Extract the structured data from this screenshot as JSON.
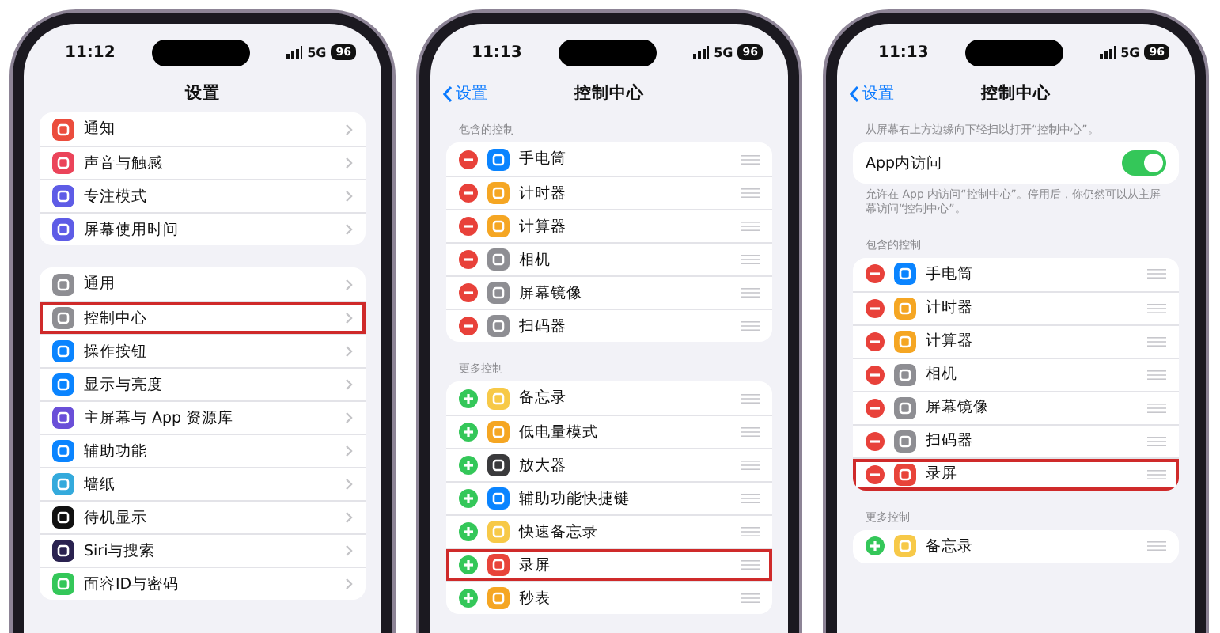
{
  "phones": [
    {
      "status_bar": {
        "time": "11:12",
        "network": "5G",
        "battery": "96"
      },
      "nav": {
        "title": "设置"
      },
      "sections": [
        {
          "rows": [
            {
              "kind": "link",
              "label": "通知",
              "color": "#eb4d3d",
              "highlighted": false
            },
            {
              "kind": "link",
              "label": "声音与触感",
              "color": "#eb445a",
              "highlighted": false
            },
            {
              "kind": "link",
              "label": "专注模式",
              "color": "#5e5ce6",
              "highlighted": false
            },
            {
              "kind": "link",
              "label": "屏幕使用时间",
              "color": "#5e5ce6",
              "highlighted": false
            }
          ]
        },
        {
          "rows": [
            {
              "kind": "link",
              "label": "通用",
              "color": "#8e8e93",
              "highlighted": false
            },
            {
              "kind": "link",
              "label": "控制中心",
              "color": "#8e8e93",
              "highlighted": true
            },
            {
              "kind": "link",
              "label": "操作按钮",
              "color": "#0a84ff",
              "highlighted": false
            },
            {
              "kind": "link",
              "label": "显示与亮度",
              "color": "#0a84ff",
              "highlighted": false
            },
            {
              "kind": "link",
              "label": "主屏幕与 App 资源库",
              "color": "#6a4fd8",
              "highlighted": false
            },
            {
              "kind": "link",
              "label": "辅助功能",
              "color": "#0a84ff",
              "highlighted": false
            },
            {
              "kind": "link",
              "label": "墙纸",
              "color": "#34aadc",
              "highlighted": false
            },
            {
              "kind": "link",
              "label": "待机显示",
              "color": "#111111",
              "highlighted": false
            },
            {
              "kind": "link",
              "label": "Siri与搜索",
              "color": "#2a2250",
              "highlighted": false
            },
            {
              "kind": "link",
              "label": "面容ID与密码",
              "color": "#34c759",
              "highlighted": false
            }
          ]
        }
      ]
    },
    {
      "status_bar": {
        "time": "11:13",
        "network": "5G",
        "battery": "96"
      },
      "nav": {
        "back": "设置",
        "title": "控制中心"
      },
      "sections": [
        {
          "header": "包含的控制",
          "rows": [
            {
              "kind": "removable",
              "label": "手电筒",
              "color": "#0a84ff",
              "highlighted": false
            },
            {
              "kind": "removable",
              "label": "计时器",
              "color": "#f5a623",
              "highlighted": false
            },
            {
              "kind": "removable",
              "label": "计算器",
              "color": "#f5a623",
              "highlighted": false
            },
            {
              "kind": "removable",
              "label": "相机",
              "color": "#8e8e93",
              "highlighted": false
            },
            {
              "kind": "removable",
              "label": "屏幕镜像",
              "color": "#8e8e93",
              "highlighted": false
            },
            {
              "kind": "removable",
              "label": "扫码器",
              "color": "#8e8e93",
              "highlighted": false
            }
          ]
        },
        {
          "header": "更多控制",
          "rows": [
            {
              "kind": "addable",
              "label": "备忘录",
              "color": "#f7c948",
              "highlighted": false
            },
            {
              "kind": "addable",
              "label": "低电量模式",
              "color": "#f5a623",
              "highlighted": false
            },
            {
              "kind": "addable",
              "label": "放大器",
              "color": "#3a3a3c",
              "highlighted": false
            },
            {
              "kind": "addable",
              "label": "辅助功能快捷键",
              "color": "#0a84ff",
              "highlighted": false
            },
            {
              "kind": "addable",
              "label": "快速备忘录",
              "color": "#f7c948",
              "highlighted": false
            },
            {
              "kind": "addable",
              "label": "录屏",
              "color": "#e8443a",
              "highlighted": true
            },
            {
              "kind": "addable",
              "label": "秒表",
              "color": "#f5a623",
              "highlighted": false
            }
          ]
        }
      ]
    },
    {
      "status_bar": {
        "time": "11:13",
        "network": "5G",
        "battery": "96"
      },
      "nav": {
        "back": "设置",
        "title": "控制中心"
      },
      "sections": [
        {
          "header": "从屏幕右上方边缘向下轻扫以打开“控制中心”。",
          "footer": "允许在 App 内访问“控制中心”。停用后，你仍然可以从主屏幕访问“控制中心”。",
          "rows": [
            {
              "kind": "toggle",
              "label": "App内访问",
              "on": true,
              "highlighted": false
            }
          ]
        },
        {
          "header": "包含的控制",
          "rows": [
            {
              "kind": "removable",
              "label": "手电筒",
              "color": "#0a84ff",
              "highlighted": false
            },
            {
              "kind": "removable",
              "label": "计时器",
              "color": "#f5a623",
              "highlighted": false
            },
            {
              "kind": "removable",
              "label": "计算器",
              "color": "#f5a623",
              "highlighted": false
            },
            {
              "kind": "removable",
              "label": "相机",
              "color": "#8e8e93",
              "highlighted": false
            },
            {
              "kind": "removable",
              "label": "屏幕镜像",
              "color": "#8e8e93",
              "highlighted": false
            },
            {
              "kind": "removable",
              "label": "扫码器",
              "color": "#8e8e93",
              "highlighted": false
            },
            {
              "kind": "removable",
              "label": "录屏",
              "color": "#e8443a",
              "highlighted": true
            }
          ]
        },
        {
          "header": "更多控制",
          "rows": [
            {
              "kind": "addable",
              "label": "备忘录",
              "color": "#f7c948",
              "highlighted": false
            }
          ]
        }
      ]
    }
  ]
}
